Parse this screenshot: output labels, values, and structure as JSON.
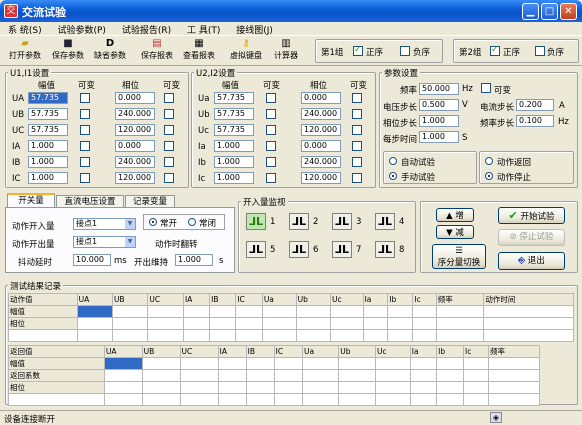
{
  "window": {
    "title": "交流试验",
    "app_icon": "交"
  },
  "menu": [
    "系 统(S)",
    "试验参数(P)",
    "试验报告(R)",
    "工 具(T)",
    "接线图(J)"
  ],
  "toolbar": {
    "open": "打开参数",
    "save": "保存参数",
    "default": "缺省参数",
    "save_report": "保存报表",
    "view_report": "查看报表",
    "virtual_kb": "虚拟键盘",
    "calc": "计算器"
  },
  "group1": {
    "label": "第1组",
    "pos": "正序",
    "neg": "负序",
    "pos_checked": true,
    "neg_checked": false
  },
  "group2": {
    "label": "第2组",
    "pos": "正序",
    "neg": "负序",
    "pos_checked": true,
    "neg_checked": false
  },
  "ui1": {
    "title": "U1,I1设置",
    "col_amp": "幅值",
    "col_var1": "可变",
    "col_phase": "相位",
    "col_var2": "可变",
    "rows": [
      {
        "name": "UA",
        "amp": "57.735",
        "phase": "0.000"
      },
      {
        "name": "UB",
        "amp": "57.735",
        "phase": "240.000"
      },
      {
        "name": "UC",
        "amp": "57.735",
        "phase": "120.000"
      },
      {
        "name": "IA",
        "amp": "1.000",
        "phase": "0.000"
      },
      {
        "name": "IB",
        "amp": "1.000",
        "phase": "240.000"
      },
      {
        "name": "IC",
        "amp": "1.000",
        "phase": "120.000"
      }
    ]
  },
  "ui2": {
    "title": "U2,I2设置",
    "col_amp": "幅值",
    "col_var1": "可变",
    "col_phase": "相位",
    "col_var2": "可变",
    "rows": [
      {
        "name": "Ua",
        "amp": "57.735",
        "phase": "0.000"
      },
      {
        "name": "Ub",
        "amp": "57.735",
        "phase": "240.000"
      },
      {
        "name": "Uc",
        "amp": "57.735",
        "phase": "120.000"
      },
      {
        "name": "Ia",
        "amp": "1.000",
        "phase": "0.000"
      },
      {
        "name": "Ib",
        "amp": "1.000",
        "phase": "240.000"
      },
      {
        "name": "Ic",
        "amp": "1.000",
        "phase": "120.000"
      }
    ]
  },
  "params": {
    "title": "参数设置",
    "freq_label": "频率",
    "freq": "50.000",
    "freq_unit": "Hz",
    "var_label": "可变",
    "vstep_label": "电压步长",
    "vstep": "0.500",
    "vstep_unit": "V",
    "istep_label": "电流步长",
    "istep": "0.200",
    "istep_unit": "A",
    "pstep_label": "相位步长",
    "pstep": "1.000",
    "fstep_label": "频率步长",
    "fstep": "0.100",
    "fstep_unit": "Hz",
    "time_label": "每步时间",
    "time": "1.000",
    "time_unit": "S",
    "auto": "自动试验",
    "manual": "手动试验",
    "act_ret": "动作返回",
    "act_stop": "动作停止"
  },
  "tabs": [
    "开关量",
    "直流电压设置",
    "记录变量"
  ],
  "switch": {
    "in_label": "动作开入量",
    "in_value": "接点1",
    "out_label": "动作开出量",
    "out_value": "接点1",
    "no": "常开",
    "nc": "常闭",
    "flip_label": "动作时翻转",
    "debounce_label": "抖动延时",
    "debounce": "10.000",
    "debounce_unit": "ms",
    "hold_label": "开出维持",
    "hold": "1.000",
    "hold_unit": "s"
  },
  "monitor": {
    "title": "开入量监视",
    "items": [
      "1",
      "2",
      "3",
      "4",
      "5",
      "6",
      "7",
      "8"
    ]
  },
  "ctrl": {
    "inc": "增",
    "dec": "减",
    "seq": "序分量切换",
    "start": "开始试验",
    "stop": "停止试验",
    "exit": "退出"
  },
  "results": {
    "title": "测试结果记录",
    "act_head": [
      "动作值",
      "UA",
      "UB",
      "UC",
      "IA",
      "IB",
      "IC",
      "Ua",
      "Ub",
      "Uc",
      "Ia",
      "Ib",
      "Ic",
      "频率",
      "动作时间"
    ],
    "act_rows": [
      "幅值",
      "相位"
    ],
    "ret_head": [
      "返回值",
      "UA",
      "UB",
      "UC",
      "IA",
      "IB",
      "IC",
      "Ua",
      "Ub",
      "Uc",
      "Ia",
      "Ib",
      "Ic",
      "频率"
    ],
    "ret_rows": [
      "幅值",
      "返回系数",
      "相位"
    ]
  },
  "status": "设备连接断开"
}
